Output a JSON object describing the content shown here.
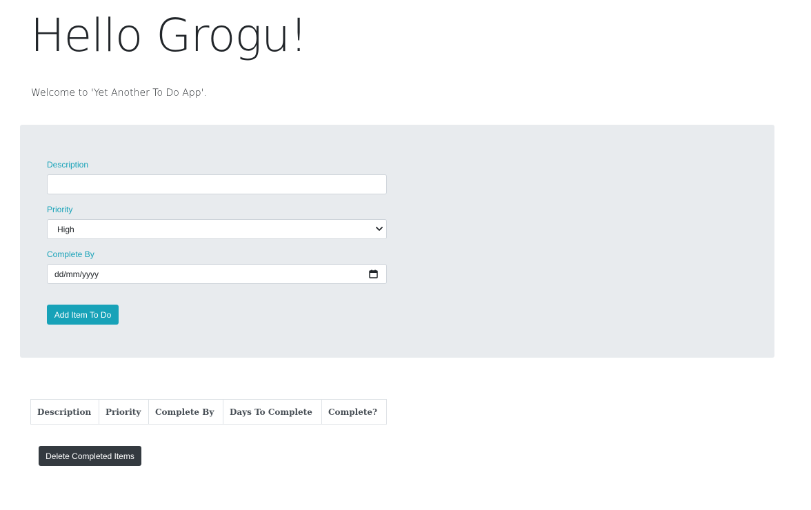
{
  "header": {
    "title": "Hello Grogu!",
    "welcome": "Welcome to 'Yet Another To Do App'."
  },
  "form": {
    "description_label": "Description",
    "description_value": "",
    "priority_label": "Priority",
    "priority_value": "High",
    "complete_by_label": "Complete By",
    "complete_by_value": "dd/mm/yyyy",
    "add_button_label": "Add Item To Do"
  },
  "table": {
    "columns": [
      "Description",
      "Priority",
      "Complete By",
      "Days To Complete",
      "Complete?"
    ]
  },
  "actions": {
    "delete_completed_label": "Delete Completed Items"
  },
  "colors": {
    "accent": "#17a2b8",
    "panel_background": "#e8ebee",
    "dark_button": "#343a40"
  }
}
